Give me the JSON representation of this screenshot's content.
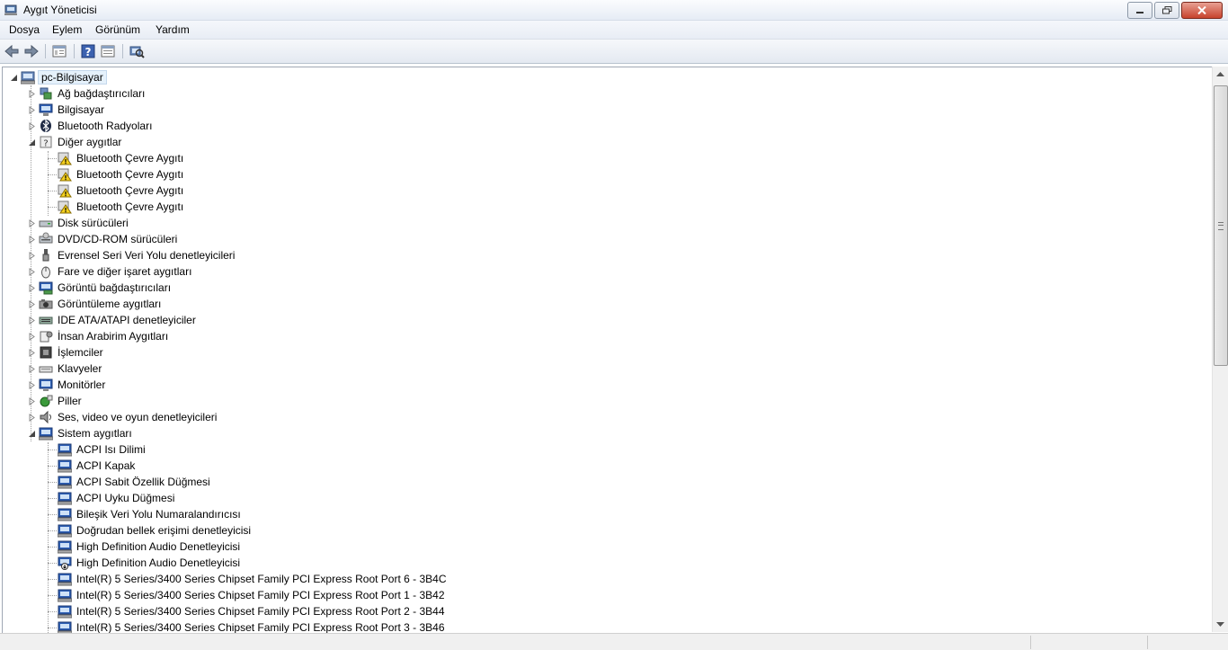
{
  "window": {
    "title": "Aygıt Yöneticisi"
  },
  "menu": [
    "Dosya",
    "Eylem",
    "Görünüm",
    "Yardım"
  ],
  "tree": {
    "root": "pc-Bilgisayar",
    "items": [
      {
        "label": "Ağ bağdaştırıcıları",
        "icon": "network-adapter-icon",
        "level": 1,
        "state": "collapsed"
      },
      {
        "label": "Bilgisayar",
        "icon": "computer-icon",
        "level": 1,
        "state": "collapsed"
      },
      {
        "label": "Bluetooth Radyoları",
        "icon": "bluetooth-icon",
        "level": 1,
        "state": "collapsed"
      },
      {
        "label": "Diğer aygıtlar",
        "icon": "unknown-device-icon",
        "level": 1,
        "state": "expanded"
      },
      {
        "label": "Bluetooth Çevre Aygıtı",
        "icon": "warning-device-icon",
        "level": 2
      },
      {
        "label": "Bluetooth Çevre Aygıtı",
        "icon": "warning-device-icon",
        "level": 2
      },
      {
        "label": "Bluetooth Çevre Aygıtı",
        "icon": "warning-device-icon",
        "level": 2
      },
      {
        "label": "Bluetooth Çevre Aygıtı",
        "icon": "warning-device-icon",
        "level": 2
      },
      {
        "label": "Disk sürücüleri",
        "icon": "disk-drive-icon",
        "level": 1,
        "state": "collapsed"
      },
      {
        "label": "DVD/CD-ROM sürücüleri",
        "icon": "dvd-drive-icon",
        "level": 1,
        "state": "collapsed"
      },
      {
        "label": "Evrensel Seri Veri Yolu denetleyicileri",
        "icon": "usb-icon",
        "level": 1,
        "state": "collapsed"
      },
      {
        "label": "Fare ve diğer işaret aygıtları",
        "icon": "mouse-icon",
        "level": 1,
        "state": "collapsed"
      },
      {
        "label": "Görüntü bağdaştırıcıları",
        "icon": "display-adapter-icon",
        "level": 1,
        "state": "collapsed"
      },
      {
        "label": "Görüntüleme aygıtları",
        "icon": "imaging-device-icon",
        "level": 1,
        "state": "collapsed"
      },
      {
        "label": "IDE ATA/ATAPI denetleyiciler",
        "icon": "ide-controller-icon",
        "level": 1,
        "state": "collapsed"
      },
      {
        "label": "İnsan Arabirim Aygıtları",
        "icon": "hid-icon",
        "level": 1,
        "state": "collapsed"
      },
      {
        "label": "İşlemciler",
        "icon": "processor-icon",
        "level": 1,
        "state": "collapsed"
      },
      {
        "label": "Klavyeler",
        "icon": "keyboard-icon",
        "level": 1,
        "state": "collapsed"
      },
      {
        "label": "Monitörler",
        "icon": "monitor-icon",
        "level": 1,
        "state": "collapsed"
      },
      {
        "label": "Piller",
        "icon": "battery-icon",
        "level": 1,
        "state": "collapsed"
      },
      {
        "label": "Ses, video ve oyun denetleyicileri",
        "icon": "speaker-icon",
        "level": 1,
        "state": "collapsed"
      },
      {
        "label": "Sistem aygıtları",
        "icon": "system-device-icon",
        "level": 1,
        "state": "expanded"
      },
      {
        "label": "ACPI Isı Dilimi",
        "icon": "system-device-icon",
        "level": 2
      },
      {
        "label": "ACPI Kapak",
        "icon": "system-device-icon",
        "level": 2
      },
      {
        "label": "ACPI Sabit Özellik Düğmesi",
        "icon": "system-device-icon",
        "level": 2
      },
      {
        "label": "ACPI Uyku Düğmesi",
        "icon": "system-device-icon",
        "level": 2
      },
      {
        "label": "Bileşik Veri Yolu Numaralandırıcısı",
        "icon": "system-device-icon",
        "level": 2
      },
      {
        "label": "Doğrudan bellek erişimi denetleyicisi",
        "icon": "system-device-icon",
        "level": 2
      },
      {
        "label": "High Definition Audio Denetleyicisi",
        "icon": "system-device-icon",
        "level": 2
      },
      {
        "label": "High Definition Audio Denetleyicisi",
        "icon": "disabled-device-icon",
        "level": 2
      },
      {
        "label": "Intel(R) 5 Series/3400 Series Chipset Family PCI Express Root Port 6 - 3B4C",
        "icon": "system-device-icon",
        "level": 2
      },
      {
        "label": "Intel(R) 5 Series/3400 Series Chipset Family PCI Express Root Port 1 - 3B42",
        "icon": "system-device-icon",
        "level": 2
      },
      {
        "label": "Intel(R) 5 Series/3400 Series Chipset Family PCI Express Root Port 2 - 3B44",
        "icon": "system-device-icon",
        "level": 2
      },
      {
        "label": "Intel(R) 5 Series/3400 Series Chipset Family PCI Express Root Port 3 - 3B46",
        "icon": "system-device-icon",
        "level": 2
      }
    ]
  },
  "colors": {
    "selection_bg": "#e5f1fb",
    "title_bar": "#e6ecf5",
    "close_button": "#c7432d"
  }
}
